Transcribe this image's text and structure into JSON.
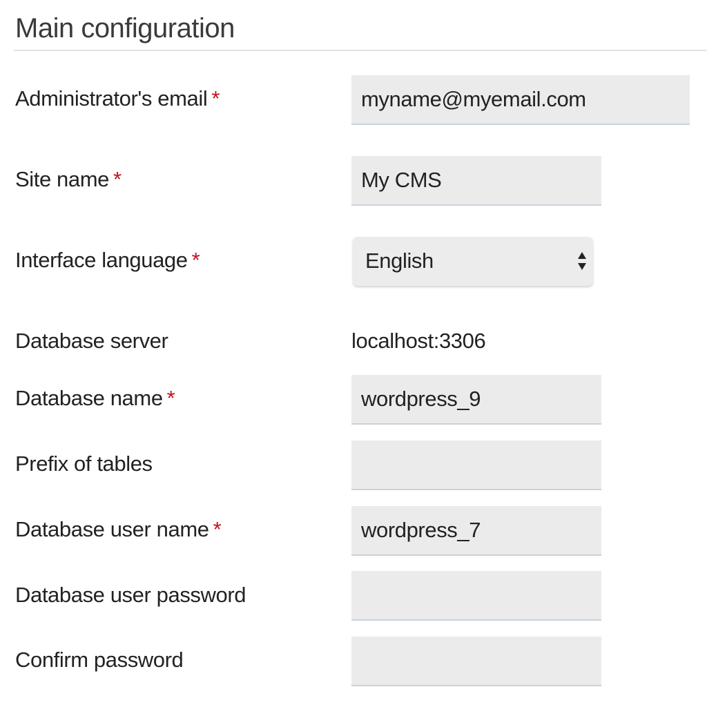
{
  "section": {
    "title": "Main configuration"
  },
  "required_marker": "*",
  "fields": {
    "admin_email": {
      "label": "Administrator's email",
      "value": "myname@myemail.com"
    },
    "site_name": {
      "label": "Site name",
      "value": "My CMS"
    },
    "interface_language": {
      "label": "Interface language",
      "selected": "English"
    },
    "database_server": {
      "label": "Database server",
      "value": "localhost:3306"
    },
    "database_name": {
      "label": "Database name",
      "value": "wordpress_9"
    },
    "table_prefix": {
      "label": "Prefix of tables",
      "value": ""
    },
    "database_user": {
      "label": "Database user name",
      "value": "wordpress_7"
    },
    "database_password": {
      "label": "Database user password",
      "value": ""
    },
    "confirm_password": {
      "label": "Confirm password",
      "value": ""
    }
  },
  "icons": {
    "select_arrow": "up-down-arrows-icon"
  },
  "colors": {
    "required": "#c4121d",
    "field_bg": "#ebebeb",
    "field_underline": "#c9d2dc"
  }
}
